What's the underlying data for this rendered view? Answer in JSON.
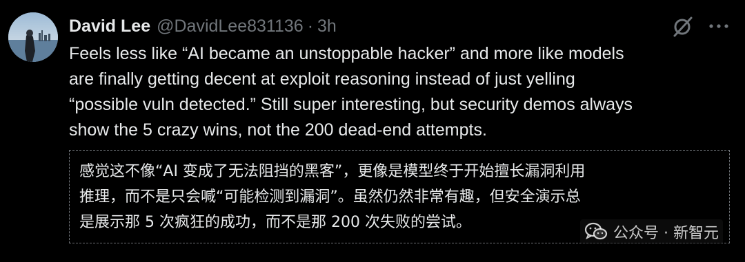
{
  "tweet": {
    "author_name": "David Lee",
    "handle": "@DavidLee831136",
    "separator": "·",
    "time": "3h",
    "body": "Feels less like “AI became an unstoppable hacker” and more like models\nare finally getting decent at exploit reasoning instead of just yelling\n“possible vuln detected.” Still super interesting, but security demos always\nshow the 5 crazy wins, not the 200 dead-end attempts.",
    "translation": "感觉这不像“AI 变成了无法阻挡的黑客”，更像是模型终于开始擅长漏洞利用\n推理，而不是只会喊“可能检测到漏洞”。虽然仍然非常有趣，但安全演示总\n是展示那 5 次疯狂的成功，而不是那 200 次失败的尝试。"
  },
  "icons": {
    "grok": "grok-icon",
    "more": "more-icon",
    "watermark": "wechat-icon"
  },
  "watermark": {
    "text": "公众号 · 新智元"
  },
  "colors": {
    "background": "#000000",
    "text_primary": "#e7e9ea",
    "text_secondary": "#71767b"
  }
}
